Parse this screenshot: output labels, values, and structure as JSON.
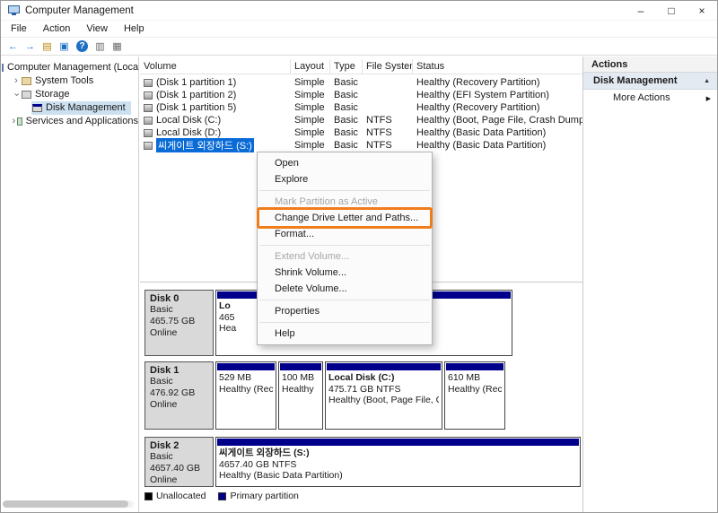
{
  "window": {
    "title": "Computer Management",
    "controls": {
      "minimize": "–",
      "maximize": "□",
      "close": "×"
    }
  },
  "menubar": {
    "items": [
      {
        "label": "File"
      },
      {
        "label": "Action"
      },
      {
        "label": "View"
      },
      {
        "label": "Help"
      }
    ]
  },
  "toolbar": {
    "icons": [
      {
        "name": "back",
        "glyph": "←"
      },
      {
        "name": "forward",
        "glyph": "→"
      },
      {
        "name": "console-tree",
        "glyph": "▤"
      },
      {
        "name": "window",
        "glyph": "▣"
      },
      {
        "name": "help",
        "glyph": "?"
      },
      {
        "name": "disk-list",
        "glyph": "▥"
      },
      {
        "name": "disk-properties",
        "glyph": "▦"
      }
    ]
  },
  "tree": {
    "root_label": "Computer Management (Local",
    "items": [
      {
        "label": "System Tools",
        "chevron": "›"
      },
      {
        "label": "Storage",
        "chevron": "›"
      },
      {
        "label": "Disk Management",
        "chevron": ""
      },
      {
        "label": "Services and Applications",
        "chevron": "›"
      }
    ]
  },
  "volume_list": {
    "columns": {
      "volume": "Volume",
      "layout": "Layout",
      "type": "Type",
      "fs": "File System",
      "status": "Status"
    },
    "rows": [
      {
        "volume": "(Disk 1 partition 1)",
        "layout": "Simple",
        "type": "Basic",
        "fs": "",
        "status": "Healthy (Recovery Partition)"
      },
      {
        "volume": "(Disk 1 partition 2)",
        "layout": "Simple",
        "type": "Basic",
        "fs": "",
        "status": "Healthy (EFI System Partition)"
      },
      {
        "volume": "(Disk 1 partition 5)",
        "layout": "Simple",
        "type": "Basic",
        "fs": "",
        "status": "Healthy (Recovery Partition)"
      },
      {
        "volume": "Local Disk (C:)",
        "layout": "Simple",
        "type": "Basic",
        "fs": "NTFS",
        "status": "Healthy (Boot, Page File, Crash Dump, Bas"
      },
      {
        "volume": "Local Disk (D:)",
        "layout": "Simple",
        "type": "Basic",
        "fs": "NTFS",
        "status": "Healthy (Basic Data Partition)"
      },
      {
        "volume": "씨게이트 외장하드 (S:)",
        "layout": "Simple",
        "type": "Basic",
        "fs": "NTFS",
        "status": "Healthy (Basic Data Partition)"
      }
    ]
  },
  "context_menu": {
    "items": [
      {
        "label": "Open"
      },
      {
        "label": "Explore"
      },
      {
        "label": "Mark Partition as Active"
      },
      {
        "label": "Change Drive Letter and Paths..."
      },
      {
        "label": "Format..."
      },
      {
        "label": "Extend Volume..."
      },
      {
        "label": "Shrink Volume..."
      },
      {
        "label": "Delete Volume..."
      },
      {
        "label": "Properties"
      },
      {
        "label": "Help"
      }
    ]
  },
  "disk_view": {
    "disks": [
      {
        "name": "Disk 0",
        "kind": "Basic",
        "size": "465.75 GB",
        "status": "Online",
        "partitions": [
          {
            "l1": "Lo",
            "l2": "465",
            "l3": "Hea"
          }
        ]
      },
      {
        "name": "Disk 1",
        "kind": "Basic",
        "size": "476.92 GB",
        "status": "Online",
        "partitions": [
          {
            "l1": "529 MB",
            "l2": "Healthy (Rec"
          },
          {
            "l1": "100 MB",
            "l2": "Healthy"
          },
          {
            "l1": "Local Disk (C:)",
            "l2": "475.71 GB NTFS",
            "l3": "Healthy (Boot, Page File, Cras"
          },
          {
            "l1": "610 MB",
            "l2": "Healthy (Rec"
          }
        ]
      },
      {
        "name": "Disk 2",
        "kind": "Basic",
        "size": "4657.40 GB",
        "status": "Online",
        "partitions": [
          {
            "l1": "씨게이트 외장하드 (S:)",
            "l2": "4657.40 GB NTFS",
            "l3": "Healthy (Basic Data Partition)"
          }
        ]
      }
    ],
    "legend": [
      {
        "label": "Unallocated",
        "color": "#000000"
      },
      {
        "label": "Primary partition",
        "color": "#00008b"
      }
    ]
  },
  "actions": {
    "header": "Actions",
    "primary": "Disk Management",
    "more": "More Actions"
  },
  "colors": {
    "selection_blue": "#0a6bd7",
    "partition_navy": "#00008b",
    "highlight_orange": "#ef7d1c"
  }
}
